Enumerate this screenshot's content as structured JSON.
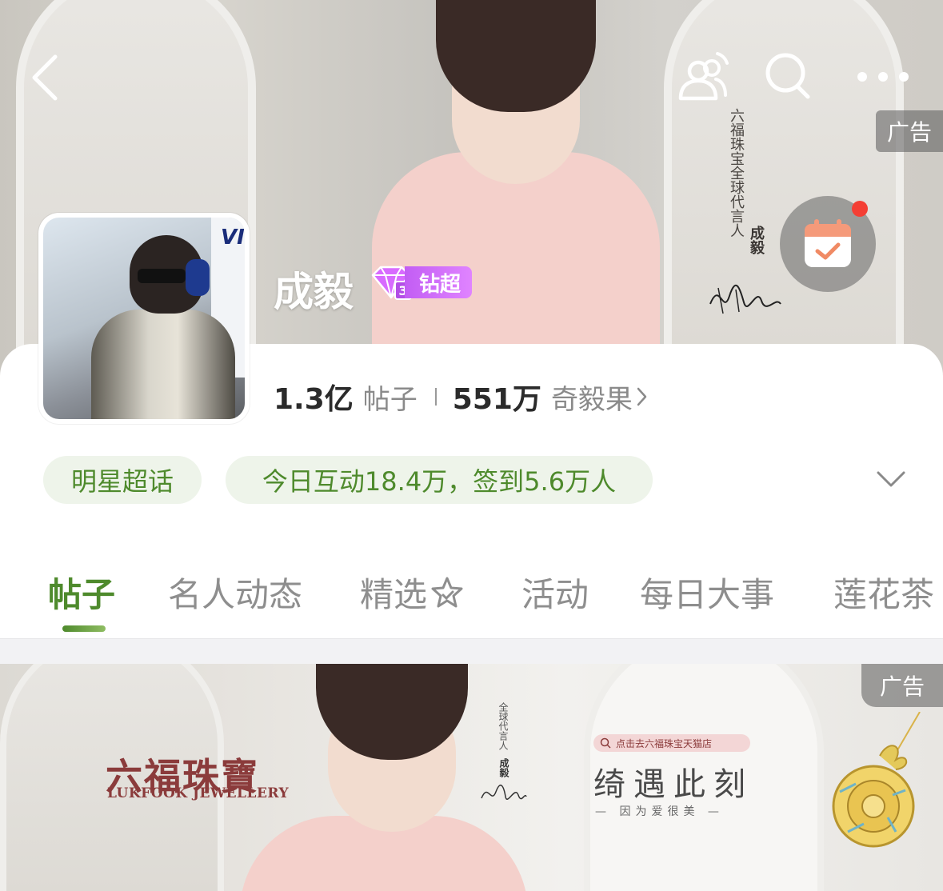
{
  "header": {
    "back_icon": "chevron-left-icon",
    "icons": [
      "people-refresh-icon",
      "search-icon",
      "more-icon"
    ],
    "ad_label": "广告",
    "ad_vertical_text": "六福珠宝全球代言人",
    "ad_vertical_name": "成毅",
    "checkin_icon": "calendar-check-icon"
  },
  "profile": {
    "name": "成毅",
    "badge_level": "3",
    "badge_label": "钻超",
    "posts_count": "1.3亿",
    "posts_label": "帖子",
    "fans_count": "551万",
    "fans_label": "奇毅果",
    "avatar_sign_text": "VI"
  },
  "pills": {
    "category": "明星超话",
    "activity": "今日互动18.4万，签到5.6万人"
  },
  "tabs": [
    {
      "label": "帖子"
    },
    {
      "label": "名人动态"
    },
    {
      "label": "精选"
    },
    {
      "label": "活动"
    },
    {
      "label": "每日大事"
    },
    {
      "label": "莲花茶"
    }
  ],
  "bottom_ad": {
    "ad_label": "广告",
    "brand_cn": "六福珠寶",
    "brand_en": "LUKFOOK JEWELLERY",
    "vertical_text": "全球代言人",
    "vertical_name": "成毅",
    "search_chip": "点击去六福珠宝天猫店",
    "slogan": "绮遇此刻",
    "sub_slogan": "— 因为爱很美 —"
  },
  "colors": {
    "accent_green": "#4e8a2c",
    "pill_bg": "#eef4ea",
    "badge_purple": "#c25df4",
    "notif_red": "#f43f34"
  }
}
